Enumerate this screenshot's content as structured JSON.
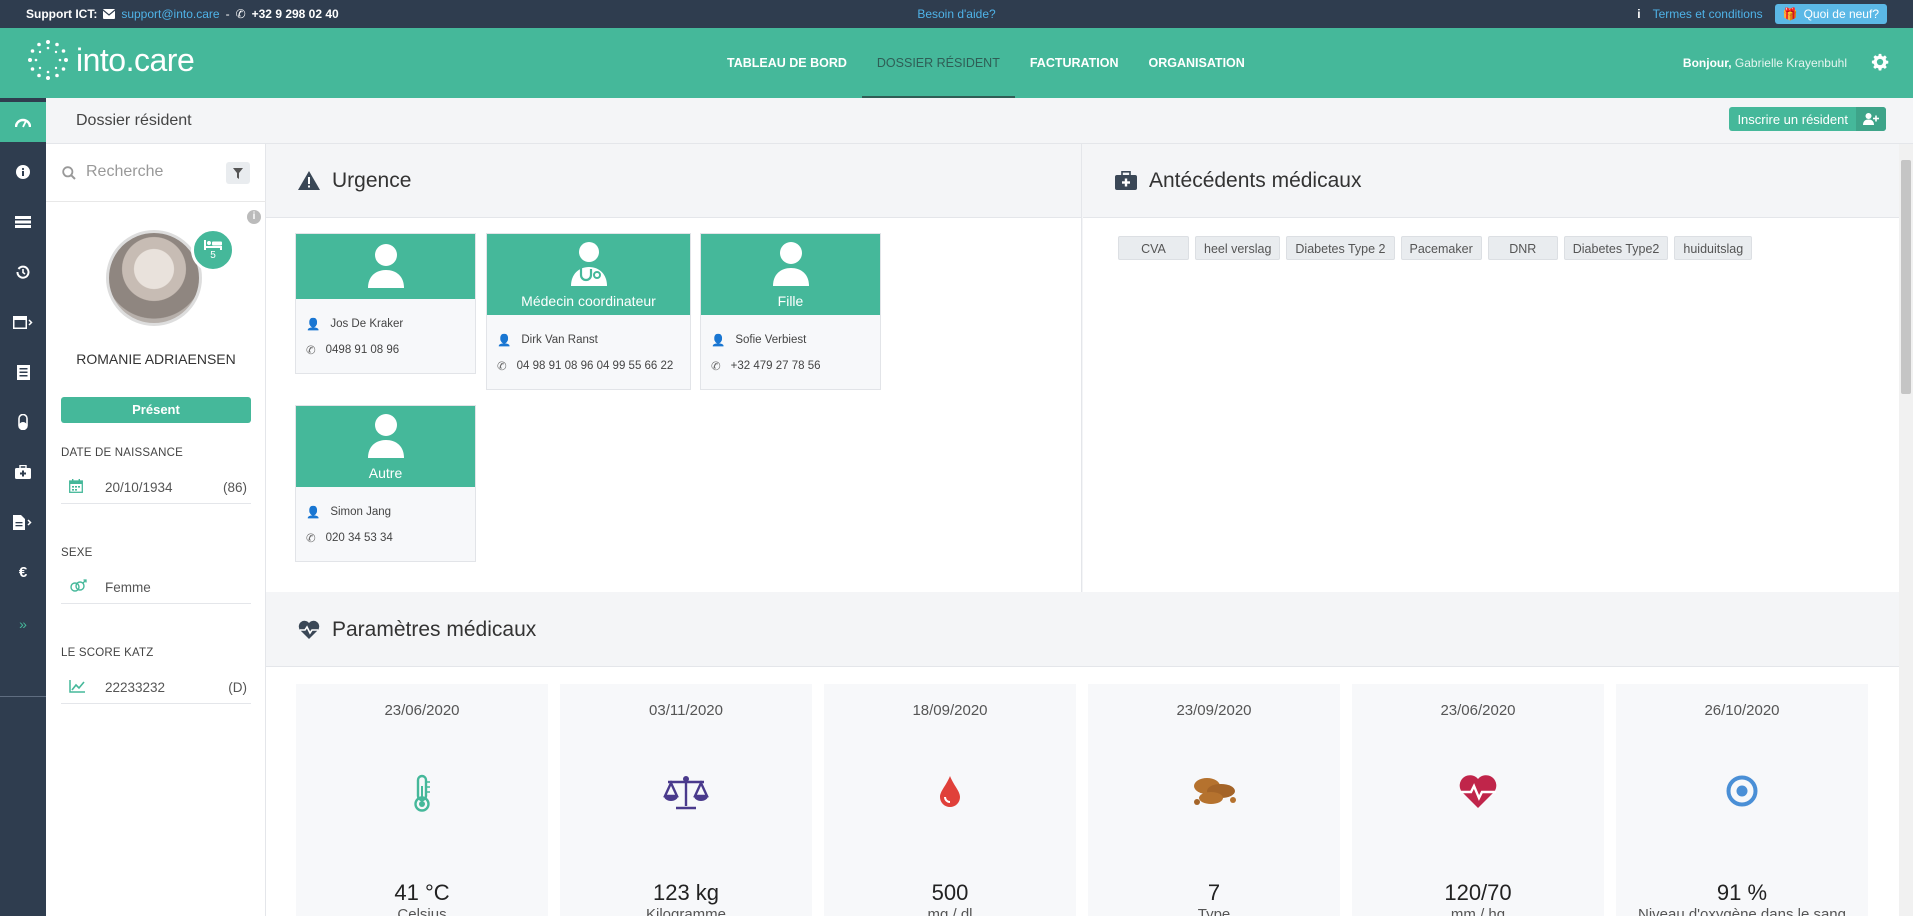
{
  "topbar": {
    "support_label": "Support ICT:",
    "email": "support@into.care",
    "separator": "-",
    "phone": "+32 9 298 02 40",
    "help": "Besoin d'aide?",
    "terms": "Termes et conditions",
    "news": "Quoi de neuf?"
  },
  "header": {
    "logo": "into.care",
    "nav": [
      "TABLEAU DE BORD",
      "DOSSIER RÉSIDENT",
      "FACTURATION",
      "ORGANISATION"
    ],
    "greeting": "Bonjour,",
    "user": "Gabrielle Krayenbuhl"
  },
  "page": {
    "title": "Dossier résident",
    "register_button": "Inscrire un résident"
  },
  "sidebar": {
    "search_placeholder": "Recherche",
    "bed_number": "5",
    "resident_name": "ROMANIE ADRIAENSEN",
    "status": "Présent",
    "dob_label": "DATE DE NAISSANCE",
    "dob": "20/10/1934",
    "age": "(86)",
    "sex_label": "SEXE",
    "sex": "Femme",
    "katz_label": "LE SCORE KATZ",
    "katz": "22233232",
    "katz_class": "(D)"
  },
  "urgence": {
    "title": "Urgence",
    "contacts": [
      {
        "role": "",
        "name": "Jos De Kraker",
        "phone": "0498 91 08 96"
      },
      {
        "role": "Médecin coordinateur",
        "name": "Dirk Van Ranst",
        "phone": "04 98 91 08 96 04 99 55 66 22"
      },
      {
        "role": "Fille",
        "name": "Sofie Verbiest",
        "phone": "+32 479 27 78 56"
      },
      {
        "role": "Autre",
        "name": "Simon Jang",
        "phone": "020 34 53 34"
      }
    ]
  },
  "antecedents": {
    "title": "Antécédents médicaux",
    "tags": [
      "CVA",
      "heel verslag",
      "Diabetes Type 2",
      "Pacemaker",
      "DNR",
      "Diabetes Type2",
      "huiduitslag"
    ]
  },
  "parametres": {
    "title": "Paramètres médicaux",
    "items": [
      {
        "date": "23/06/2020",
        "icon": "thermometer-icon",
        "value": "41 °C",
        "unit": "Celsius",
        "color": "#45b89a"
      },
      {
        "date": "03/11/2020",
        "icon": "scale-icon",
        "value": "123 kg",
        "unit": "Kilogramme",
        "color": "#4a3a8c"
      },
      {
        "date": "18/09/2020",
        "icon": "blood-drop-icon",
        "value": "500",
        "unit": "mg / dl",
        "color": "#e0403a"
      },
      {
        "date": "23/09/2020",
        "icon": "stool-icon",
        "value": "7",
        "unit": "Type",
        "color": "#b5722e"
      },
      {
        "date": "23/06/2020",
        "icon": "heartbeat-icon",
        "value": "120/70",
        "unit": "mm / hg",
        "color": "#c0254a"
      },
      {
        "date": "26/10/2020",
        "icon": "oxygen-icon",
        "value": "91 %",
        "unit": "Niveau d'oxygène dans le sang",
        "color": "#4a8fd6"
      }
    ]
  }
}
